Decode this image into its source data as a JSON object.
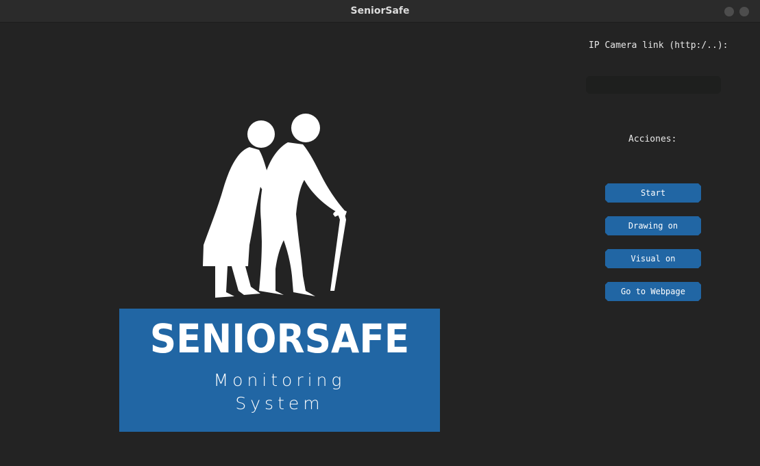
{
  "window": {
    "title": "SeniorSafe"
  },
  "logo": {
    "title": "SENIORSAFE",
    "subtitle_line1": "Monitoring",
    "subtitle_line2": "System",
    "box_color": "#2166a4"
  },
  "panel": {
    "ip_label": "IP Camera link (http:/..):",
    "ip_value": "",
    "actions_label": "Acciones:",
    "buttons": {
      "start": "Start",
      "drawing": "Drawing on",
      "visual": "Visual on",
      "webpage": "Go to Webpage"
    },
    "accent_color": "#2166a4"
  }
}
